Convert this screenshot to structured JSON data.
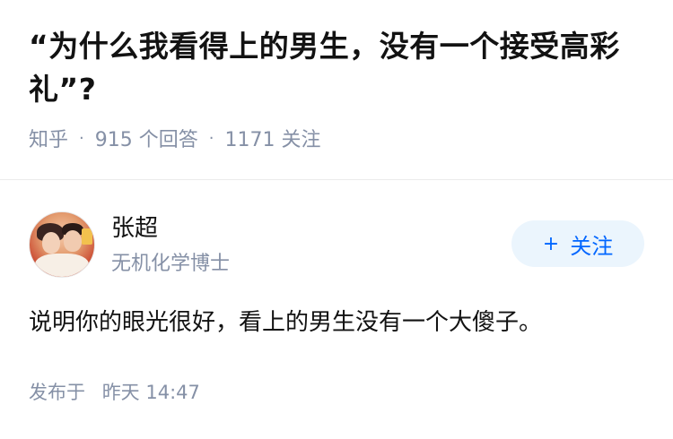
{
  "question": {
    "title": "“为什么我看得上的男生，没有一个接受高彩礼”?",
    "source": "知乎",
    "answers_count": "915 个回答",
    "followers_count": "1171 关注"
  },
  "author": {
    "name": "张超",
    "bio": "无机化学博士",
    "follow_label": "关注",
    "follow_icon": "plus-icon"
  },
  "answer": {
    "content": "说明你的眼光很好，看上的男生没有一个大傻子。",
    "published_prefix": "发布于",
    "published_time": "昨天 14:47"
  },
  "colors": {
    "accent": "#0066ff",
    "follow_bg": "#ebf5fd",
    "meta_gray": "#8590a6",
    "text": "#121212"
  }
}
